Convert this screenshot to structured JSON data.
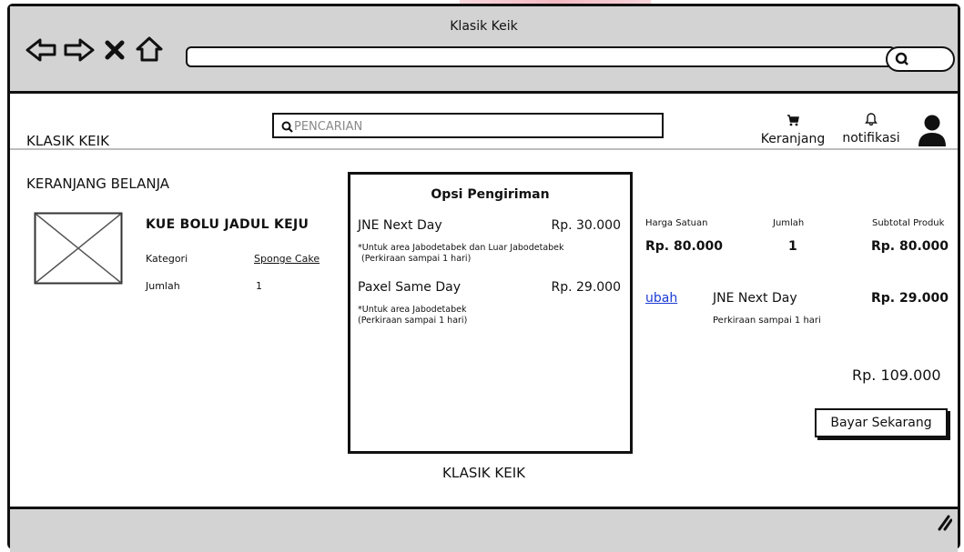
{
  "window": {
    "title": "Klasik Keik"
  },
  "icons": {
    "back": "arrow-left-icon",
    "forward": "arrow-right-icon",
    "close": "close-icon",
    "home": "home-icon",
    "search": "search-icon",
    "cart": "cart-icon",
    "bell": "bell-icon",
    "user": "user-icon"
  },
  "browser": {
    "url": ""
  },
  "header": {
    "brand": "KLASIK KEIK",
    "search_placeholder": "PENCARIAN",
    "cart_label": "Keranjang",
    "notif_label": "notifikasi"
  },
  "cart": {
    "title": "KERANJANG BELANJA",
    "product": {
      "name": "KUE BOLU JADUL KEJU",
      "category_label": "Kategori",
      "category_value": "Sponge Cake",
      "qty_label": "Jumlah",
      "qty_value": "1"
    }
  },
  "shipping": {
    "title": "Opsi Pengiriman",
    "options": [
      {
        "name": "JNE Next Day",
        "price": "Rp. 30.000",
        "note1": "*Untuk area Jabodetabek dan Luar Jabodetabek",
        "note2": "(Perkiraan sampai 1 hari)"
      },
      {
        "name": "Paxel Same Day",
        "price": "Rp. 29.000",
        "note1": "*Untuk area Jabodetabek",
        "note2": "(Perkiraan sampai 1 hari)"
      }
    ]
  },
  "summary": {
    "unit_price_label": "Harga Satuan",
    "qty_label": "Jumlah",
    "subtotal_label": "Subtotal Produk",
    "unit_price": "Rp. 80.000",
    "qty": "1",
    "subtotal": "Rp. 80.000",
    "change_link": "ubah",
    "selected_shipping": "JNE Next Day",
    "selected_shipping_price": "Rp. 29.000",
    "estimate": "Perkiraan sampai 1 hari",
    "total": "Rp. 109.000",
    "pay_button": "Bayar Sekarang"
  },
  "footer": {
    "brand": "KLASIK KEIK"
  }
}
